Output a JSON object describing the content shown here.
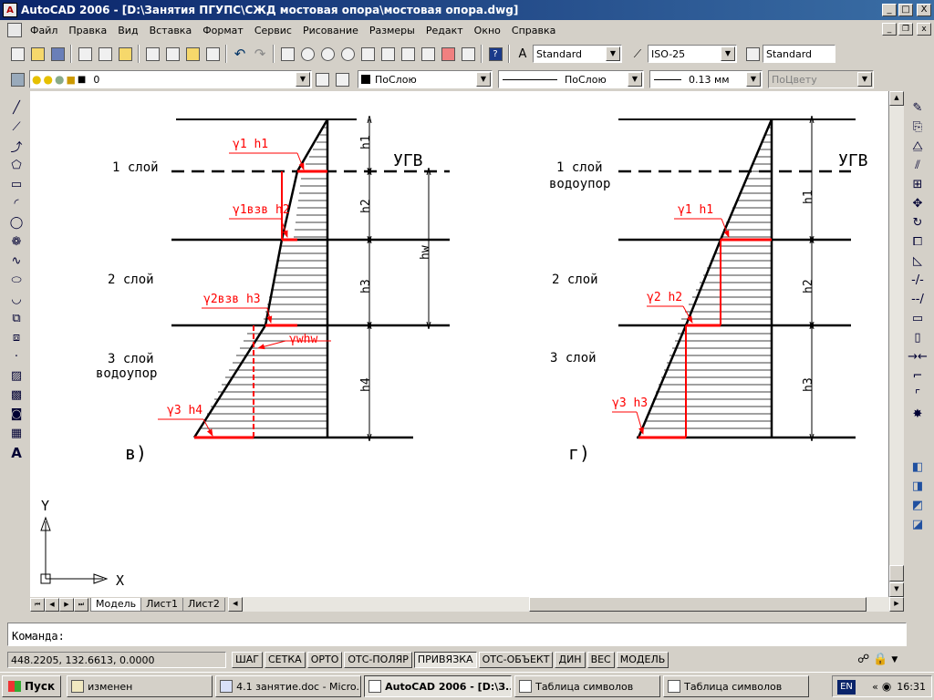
{
  "window": {
    "title": "AutoCAD 2006 - [D:\\Занятия ПГУПС\\СЖД мостовая опора\\мостовая опора.dwg]",
    "min_label": "_",
    "max_label": "□",
    "close_label": "X"
  },
  "menu": {
    "items": [
      "Файл",
      "Правка",
      "Вид",
      "Вставка",
      "Формат",
      "Сервис",
      "Рисование",
      "Размеры",
      "Редакт",
      "Окно",
      "Справка"
    ]
  },
  "toolbar_styles": {
    "text_style": "Standard",
    "dim_style": "ISO-25",
    "table_style": "Standard"
  },
  "toolbar_layers": {
    "layer": "0",
    "color": "ПоСлою",
    "linetype": "ПоСлою",
    "lineweight": "0.13 мм",
    "plotstyle": "ПоЦвету"
  },
  "drawing_texts": {
    "left": {
      "layer1": "1 слой",
      "layer2": "2 слой",
      "layer3": "3 слой",
      "layer3b": "водоупор",
      "ugv": "УГВ",
      "g1h1": "γ1 h1",
      "g1vzv": "γ1взв h2",
      "g2vzv": "γ2взв h3",
      "gwhw": "γwhw",
      "g3h4": "γ3 h4",
      "h1": "h1",
      "h2": "h2",
      "h3": "h3",
      "h4": "h4",
      "hw": "hw",
      "caption": "в)"
    },
    "right": {
      "layer1": "1 слой",
      "layer1b": "водоупор",
      "layer2": "2 слой",
      "layer3": "3 слой",
      "ugv": "УГВ",
      "g1h1": "γ1 h1",
      "g2h2": "γ2 h2",
      "g3h3": "γ3 h3",
      "h1": "h1",
      "h2": "h2",
      "h3": "h3",
      "caption": "г)"
    },
    "ucs_y": "Y",
    "ucs_x": "X"
  },
  "layout_tabs": [
    "Модель",
    "Лист1",
    "Лист2"
  ],
  "command": {
    "prompt": "Команда:"
  },
  "status": {
    "coords": "448.2205, 132.6613, 0.0000",
    "buttons": [
      {
        "label": "ШАГ",
        "on": false
      },
      {
        "label": "СЕТКА",
        "on": false
      },
      {
        "label": "ОРТО",
        "on": false
      },
      {
        "label": "ОТС-ПОЛЯР",
        "on": false
      },
      {
        "label": "ПРИВЯЗКА",
        "on": true
      },
      {
        "label": "ОТС-ОБЪЕКТ",
        "on": false
      },
      {
        "label": "ДИН",
        "on": false
      },
      {
        "label": "ВЕС",
        "on": false
      },
      {
        "label": "МОДЕЛЬ",
        "on": false
      }
    ]
  },
  "taskbar": {
    "start": "Пуск",
    "tasks": [
      {
        "label": "изменен",
        "active": false
      },
      {
        "label": "4.1 занятие.doc - Micro...",
        "active": false
      },
      {
        "label": "AutoCAD 2006 - [D:\\З...",
        "active": true
      },
      {
        "label": "Таблица символов",
        "active": false
      },
      {
        "label": "Таблица символов",
        "active": false
      }
    ],
    "lang": "EN",
    "time": "16:31"
  },
  "colors": {
    "accent_red": "#ff0000",
    "title_blue": "#0a246a"
  }
}
